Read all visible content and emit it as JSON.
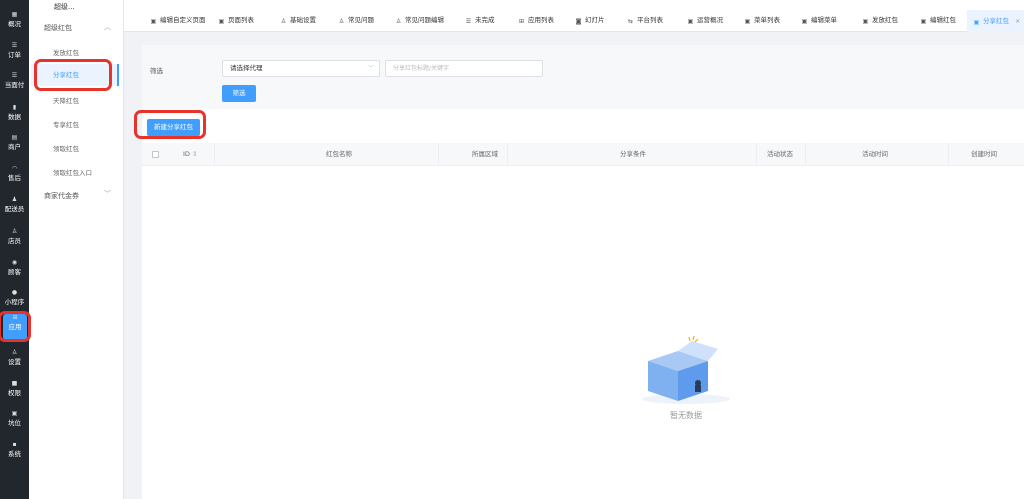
{
  "rail": {
    "items": [
      {
        "label": "概况",
        "icon": "grid-icon",
        "glyph": "▦"
      },
      {
        "label": "订单",
        "icon": "list-icon",
        "glyph": "☰"
      },
      {
        "label": "当面付",
        "icon": "list-icon",
        "glyph": "☰"
      },
      {
        "label": "数据",
        "icon": "chart-icon",
        "glyph": "▮"
      },
      {
        "label": "商户",
        "icon": "store-icon",
        "glyph": "▤"
      },
      {
        "label": "售后",
        "icon": "headset-icon",
        "glyph": "◠"
      },
      {
        "label": "配送员",
        "icon": "courier-icon",
        "glyph": "♟"
      },
      {
        "label": "店员",
        "icon": "clerk-icon",
        "glyph": "♙"
      },
      {
        "label": "顾客",
        "icon": "customer-icon",
        "glyph": "◉"
      },
      {
        "label": "小程序",
        "icon": "miniprogram-icon",
        "glyph": "●"
      },
      {
        "label": "应用",
        "icon": "apps-icon",
        "glyph": "⊞"
      },
      {
        "label": "设置",
        "icon": "settings-icon",
        "glyph": "♙"
      },
      {
        "label": "权限",
        "icon": "lock-icon",
        "glyph": "■"
      },
      {
        "label": "坑位",
        "icon": "slot-icon",
        "glyph": "▣"
      },
      {
        "label": "系统",
        "icon": "system-icon",
        "glyph": "▪"
      }
    ],
    "active_index": 10
  },
  "subnav": {
    "title": "超级...",
    "group1": "超级红包",
    "items": [
      "发放红包",
      "分享红包",
      "天降红包",
      "专享红包",
      "领取红包",
      "领取红包入口"
    ],
    "active_index": 1,
    "group2": "商家代金券",
    "chev_up": "︿",
    "chev_down": "﹀"
  },
  "tabs": [
    {
      "label": "编辑自定义页面",
      "icon": "page-icon",
      "glyph": "▣"
    },
    {
      "label": "页面列表",
      "icon": "page-icon",
      "glyph": "▣"
    },
    {
      "label": "基础设置",
      "icon": "user-settings-icon",
      "glyph": "♙"
    },
    {
      "label": "常见问题",
      "icon": "user-settings-icon",
      "glyph": "♙"
    },
    {
      "label": "常见问题编辑",
      "icon": "user-settings-icon",
      "glyph": "♙"
    },
    {
      "label": "未完成",
      "icon": "list-icon",
      "glyph": "☰"
    },
    {
      "label": "应用列表",
      "icon": "apps-icon",
      "glyph": "⊞"
    },
    {
      "label": "幻灯片",
      "icon": "slideshow-icon",
      "glyph": "◙"
    },
    {
      "label": "平台列表",
      "icon": "platform-icon",
      "glyph": "⇆"
    },
    {
      "label": "运营概况",
      "icon": "page-icon",
      "glyph": "▣"
    },
    {
      "label": "菜单列表",
      "icon": "page-icon",
      "glyph": "▣"
    },
    {
      "label": "编辑菜单",
      "icon": "page-icon",
      "glyph": "▣"
    },
    {
      "label": "发放红包",
      "icon": "page-icon",
      "glyph": "▣"
    },
    {
      "label": "编辑红包",
      "icon": "page-icon",
      "glyph": "▣"
    },
    {
      "label": "分享红包",
      "icon": "page-icon",
      "glyph": "▣",
      "close": "×"
    }
  ],
  "filter": {
    "label": "筛选",
    "select_value": "请选择代理",
    "input_placeholder": "分享红包标题/关键字",
    "button": "筛选"
  },
  "new_button": "新建分享红包",
  "table": {
    "columns": [
      "ID",
      "红包名称",
      "所属区域",
      "分享条件",
      "活动状态",
      "活动时间",
      "创建时间"
    ],
    "sort_glyph": "⇕",
    "empty_text": "暂无数据"
  },
  "colors": {
    "accent": "#409eff",
    "highlight": "#e8332a",
    "rail": "#22272e"
  }
}
